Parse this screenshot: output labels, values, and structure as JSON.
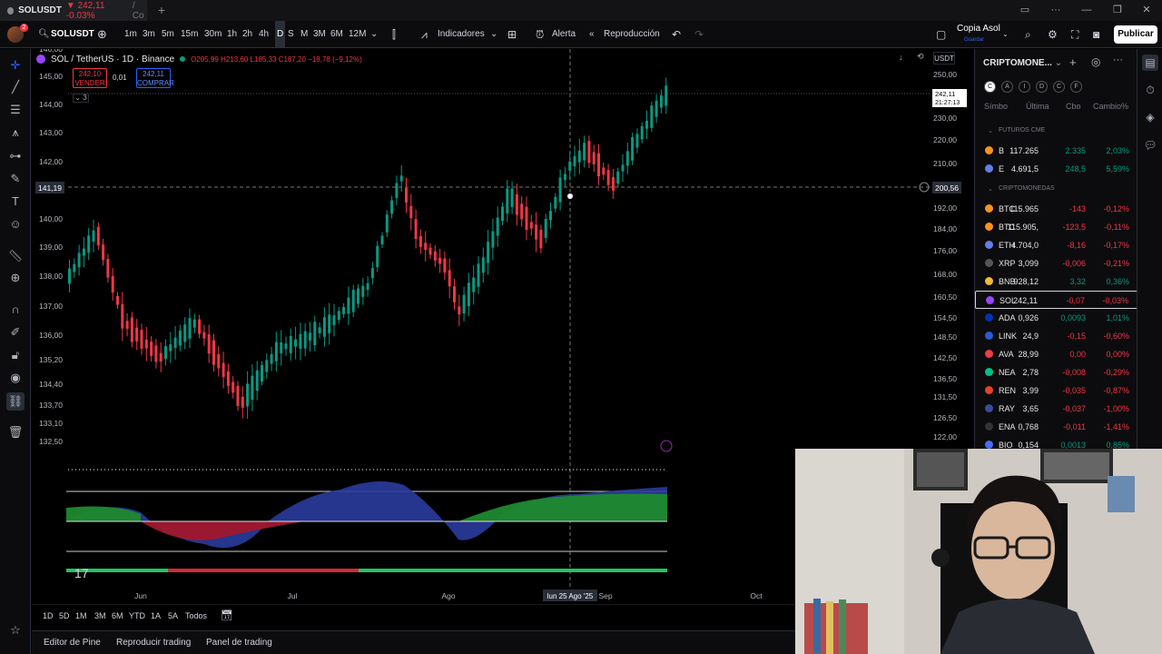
{
  "browser_tab": {
    "title": "SOLUSDT",
    "price": "242,11",
    "change": "-0.03%",
    "suffix": "/ Co"
  },
  "toolbar": {
    "symbol": "SOLUSDT",
    "timeframes": [
      "1m",
      "3m",
      "5m",
      "15m",
      "30m",
      "1h",
      "2h",
      "4h",
      "D",
      "S",
      "M",
      "3M",
      "6M",
      "12M"
    ],
    "active_timeframe": "D",
    "indicators_label": "Indicadores",
    "alert_label": "Alerta",
    "replay_label": "Reproducción",
    "layout_name": "Copia Asol",
    "layout_sub": "Guardar",
    "publish_label": "Publicar",
    "notif_count": "2"
  },
  "chart": {
    "title": "SOL / TetherUS · 1D · Binance",
    "ohlc": "O205,99 H213,60 L185,33 C187,20 −18,78 (−9,12%)",
    "sell_price": "242,10",
    "sell_label": "VENDER",
    "buy_price": "242,11",
    "buy_label": "COMPRAR",
    "qty": "0,01",
    "collapse_count": "3",
    "currency": "USDT",
    "left_axis": [
      "146,00",
      "145,00",
      "144,00",
      "143,00",
      "142,00",
      "141,19",
      "140,00",
      "139,00",
      "138,00",
      "137,00",
      "136,00",
      "135,20",
      "134,40",
      "133,70",
      "133,10",
      "132,50"
    ],
    "right_axis": [
      "250,00",
      "240,00",
      "230,00",
      "220,00",
      "210,00",
      "200,56",
      "192,00",
      "184,00",
      "176,00",
      "168,00",
      "160,50",
      "154,50",
      "148,50",
      "142,50",
      "136,50",
      "131,50",
      "126,50",
      "122,00"
    ],
    "last_price": "242,11",
    "countdown": "21:27:13",
    "crosshair_left": "141,19",
    "crosshair_right": "200,56",
    "x_labels": [
      "Jun",
      "Jul",
      "Ago",
      "Sep",
      "Oct"
    ],
    "crosshair_date": "lun 25 Ago '25",
    "logo": "17"
  },
  "range_bar": {
    "ranges": [
      "1D",
      "5D",
      "1M",
      "3M",
      "6M",
      "YTD",
      "1A",
      "5A",
      "Todos"
    ]
  },
  "bottom_bar": {
    "panels": [
      "Editor de Pine",
      "Reproducir trading",
      "Panel de trading"
    ]
  },
  "watchlist": {
    "title": "CRIPTOMONE...",
    "filter_tabs": [
      "C",
      "A",
      "I",
      "D",
      "C",
      "F"
    ],
    "columns": [
      "Símbo",
      "Última",
      "Cbo",
      "Cambio%"
    ],
    "sections": [
      {
        "name": "FUTUROS CME",
        "rows": [
          {
            "sym": "B",
            "last": "117.265",
            "chg": "2.335",
            "pct": "2,03%",
            "dir": "up",
            "color": "#f7931a"
          },
          {
            "sym": "E",
            "last": "4.691,5",
            "chg": "248,5",
            "pct": "5,59%",
            "dir": "up",
            "color": "#627eea"
          }
        ]
      },
      {
        "name": "CRIPTOMONEDAS",
        "rows": [
          {
            "sym": "BTC",
            "last": "115.965",
            "chg": "-143",
            "pct": "-0,12%",
            "dir": "down",
            "color": "#f7931a"
          },
          {
            "sym": "BTC",
            "last": "115.905,",
            "chg": "-123,5",
            "pct": "-0,11%",
            "dir": "down",
            "color": "#f7931a"
          },
          {
            "sym": "ETH",
            "last": "4.704,0",
            "chg": "-8,16",
            "pct": "-0,17%",
            "dir": "down",
            "color": "#627eea"
          },
          {
            "sym": "XRP",
            "last": "3,099",
            "chg": "-0,006",
            "pct": "-0,21%",
            "dir": "down",
            "color": "#555555"
          },
          {
            "sym": "BNB",
            "last": "928,12",
            "chg": "3,32",
            "pct": "0,36%",
            "dir": "up",
            "color": "#f3ba2f"
          },
          {
            "sym": "SOL",
            "last": "242,11",
            "chg": "-0,07",
            "pct": "-0,03%",
            "dir": "down",
            "color": "#9945ff"
          },
          {
            "sym": "ADA",
            "last": "0,926",
            "chg": "0,0093",
            "pct": "1,01%",
            "dir": "up",
            "color": "#0033ad"
          },
          {
            "sym": "LINK",
            "last": "24,9",
            "chg": "-0,15",
            "pct": "-0,60%",
            "dir": "down",
            "color": "#2a5ada"
          },
          {
            "sym": "AVA",
            "last": "28,99",
            "chg": "0,00",
            "pct": "0,00%",
            "dir": "down",
            "color": "#e84142"
          },
          {
            "sym": "NEA",
            "last": "2,78",
            "chg": "-0,008",
            "pct": "-0,29%",
            "dir": "down",
            "color": "#00c08b"
          },
          {
            "sym": "REN",
            "last": "3,99",
            "chg": "-0,035",
            "pct": "-0,87%",
            "dir": "down",
            "color": "#e8402a"
          },
          {
            "sym": "RAY",
            "last": "3,65",
            "chg": "-0,037",
            "pct": "-1,00%",
            "dir": "down",
            "color": "#3b4c9c"
          },
          {
            "sym": "ENA",
            "last": "0,768",
            "chg": "-0,011",
            "pct": "-1,41%",
            "dir": "down",
            "color": "#333333"
          },
          {
            "sym": "BIO",
            "last": "0,154",
            "chg": "0,0013",
            "pct": "0,85%",
            "dir": "up",
            "color": "#4a6cff"
          }
        ]
      }
    ]
  },
  "colors": {
    "up": "#089981",
    "down": "#f23645",
    "accent": "#2962ff",
    "bg": "#000000"
  }
}
